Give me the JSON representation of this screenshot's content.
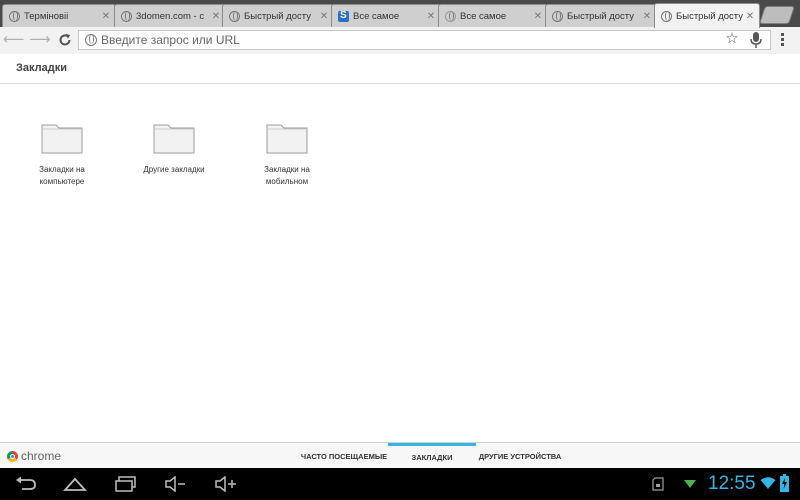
{
  "tabs": [
    {
      "title": "Терміновіі",
      "favicon": "globe-icon",
      "active": false
    },
    {
      "title": "3domen.com - с",
      "favicon": "globe-icon",
      "active": false
    },
    {
      "title": "Быстрый досту",
      "favicon": "globe-icon",
      "active": false
    },
    {
      "title": "Все самое",
      "favicon": "s-logo-icon",
      "active": false
    },
    {
      "title": "Все самое",
      "favicon": "loading-icon",
      "active": false
    },
    {
      "title": "Быстрый досту",
      "favicon": "globe-icon",
      "active": false
    },
    {
      "title": "Быстрый досту",
      "favicon": "globe-icon",
      "active": true
    }
  ],
  "toolbar": {
    "omnibox_placeholder": "Введите запрос или URL"
  },
  "page": {
    "title": "Закладки"
  },
  "folders": [
    {
      "label": "Закладки на компьютере"
    },
    {
      "label": "Другие закладки"
    },
    {
      "label": "Закладки на мобильном"
    }
  ],
  "bottombar": {
    "brand": "chrome",
    "tabs": [
      {
        "label": "ЧАСТО ПОСЕЩАЕМЫЕ",
        "active": false
      },
      {
        "label": "ЗАКЛАДКИ",
        "active": true
      },
      {
        "label": "ДРУГИЕ УСТРОЙСТВА",
        "active": false
      }
    ]
  },
  "system": {
    "time": "12:55"
  },
  "colors": {
    "accent": "#33b5e5",
    "tabstrip": "#4a4a4a"
  }
}
